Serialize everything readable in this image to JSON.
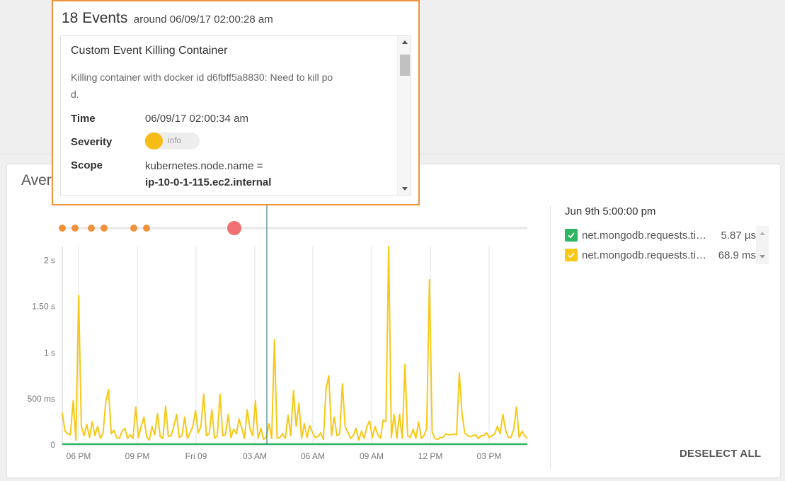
{
  "popup": {
    "count_label": "18 Events",
    "around_label": "around 06/09/17 02:00:28 am",
    "event": {
      "title": "Custom Event Killing Container",
      "description_line1": "Killing container with docker id d6fbff5a8830: Need to kill po",
      "description_line2": "d.",
      "time_label": "Time",
      "time_value": "06/09/17 02:00:34 am",
      "severity_label": "Severity",
      "severity_value": "info",
      "scope_label": "Scope",
      "scope_key": "kubernetes.node.name =",
      "scope_value": "ip-10-0-1-115.ec2.internal"
    }
  },
  "panel": {
    "title": "Aver"
  },
  "legend": {
    "date": "Jun 9th 5:00:00 pm",
    "items": [
      {
        "name": "net.mongodb.requests.time.avg",
        "value": "5.87 µs",
        "color": "#2fb463",
        "checked": true
      },
      {
        "name": "net.mongodb.requests.time.max",
        "value": "68.9 ms",
        "color": "#f7c817",
        "checked": true
      }
    ],
    "deselect_label": "DESELECT ALL"
  },
  "chart_data": {
    "type": "line",
    "x_ticks": [
      "06 PM",
      "09 PM",
      "Fri 09",
      "03 AM",
      "06 AM",
      "09 AM",
      "12 PM",
      "03 PM"
    ],
    "y_ticks": [
      "0",
      "500 ms",
      "1 s",
      "1.50 s",
      "2 s"
    ],
    "ylim": [
      0,
      2.15
    ],
    "y_unit": "s",
    "cursor_time": "06/09/17 02:00:28 am",
    "event_markers": [
      {
        "color": "#f0913b",
        "size": "small"
      },
      {
        "color": "#f0913b",
        "size": "small"
      },
      {
        "color": "#f0913b",
        "size": "small"
      },
      {
        "color": "#f0913b",
        "size": "small"
      },
      {
        "color": "#f0913b",
        "size": "small"
      },
      {
        "color": "#f0913b",
        "size": "small"
      },
      {
        "color": "#f07070",
        "size": "large"
      }
    ],
    "series": [
      {
        "name": "net.mongodb.requests.time.max",
        "color": "#f7c817",
        "values": [
          0.35,
          0.15,
          0.12,
          0.11,
          0.48,
          0.05,
          1.62,
          0.2,
          0.1,
          0.22,
          0.08,
          0.25,
          0.1,
          0.2,
          0.07,
          0.13,
          0.47,
          0.6,
          0.12,
          0.16,
          0.08,
          0.07,
          0.15,
          0.18,
          0.07,
          0.11,
          0.07,
          0.41,
          0.08,
          0.2,
          0.3,
          0.09,
          0.05,
          0.2,
          0.11,
          0.34,
          0.09,
          0.07,
          0.42,
          0.09,
          0.1,
          0.2,
          0.33,
          0.08,
          0.1,
          0.3,
          0.07,
          0.13,
          0.2,
          0.37,
          0.13,
          0.2,
          0.55,
          0.1,
          0.12,
          0.38,
          0.07,
          0.1,
          0.55,
          0.1,
          0.11,
          0.33,
          0.08,
          0.17,
          0.12,
          0.28,
          0.18,
          0.07,
          0.38,
          0.18,
          0.1,
          0.48,
          0.07,
          0.18,
          0.06,
          0.08,
          0.23,
          0.07,
          1.14,
          0.07,
          0.08,
          0.12,
          0.07,
          0.32,
          0.1,
          0.59,
          0.2,
          0.45,
          0.07,
          0.23,
          0.08,
          0.21,
          0.13,
          0.08,
          0.09,
          0.13,
          0.06,
          0.61,
          0.75,
          0.1,
          0.3,
          0.1,
          0.12,
          0.66,
          0.2,
          0.14,
          0.07,
          0.1,
          0.18,
          0.05,
          0.15,
          0.07,
          0.2,
          0.26,
          0.08,
          0.2,
          0.11,
          0.07,
          0.27,
          0.25,
          2.15,
          0.08,
          0.33,
          0.07,
          0.33,
          0.07,
          0.87,
          0.1,
          0.08,
          0.17,
          0.07,
          0.25,
          0.07,
          0.1,
          0.18,
          1.79,
          0.14,
          0.07,
          0.06,
          0.08,
          0.08,
          0.12,
          0.11,
          0.11,
          0.12,
          0.11,
          0.78,
          0.33,
          0.13,
          0.1,
          0.09,
          0.1,
          0.11,
          0.07,
          0.1,
          0.1,
          0.13,
          0.08,
          0.1,
          0.12,
          0.2,
          0.12,
          0.33,
          0.16,
          0.08,
          0.08,
          0.17,
          0.41,
          0.08,
          0.15,
          0.1,
          0.07
        ]
      },
      {
        "name": "net.mongodb.requests.time.avg",
        "color": "#2fb463",
        "values": [
          0.0,
          0.0,
          0.0,
          0.0,
          0.0,
          0.0,
          0.0,
          0.0,
          0.0,
          0.0
        ]
      }
    ]
  }
}
